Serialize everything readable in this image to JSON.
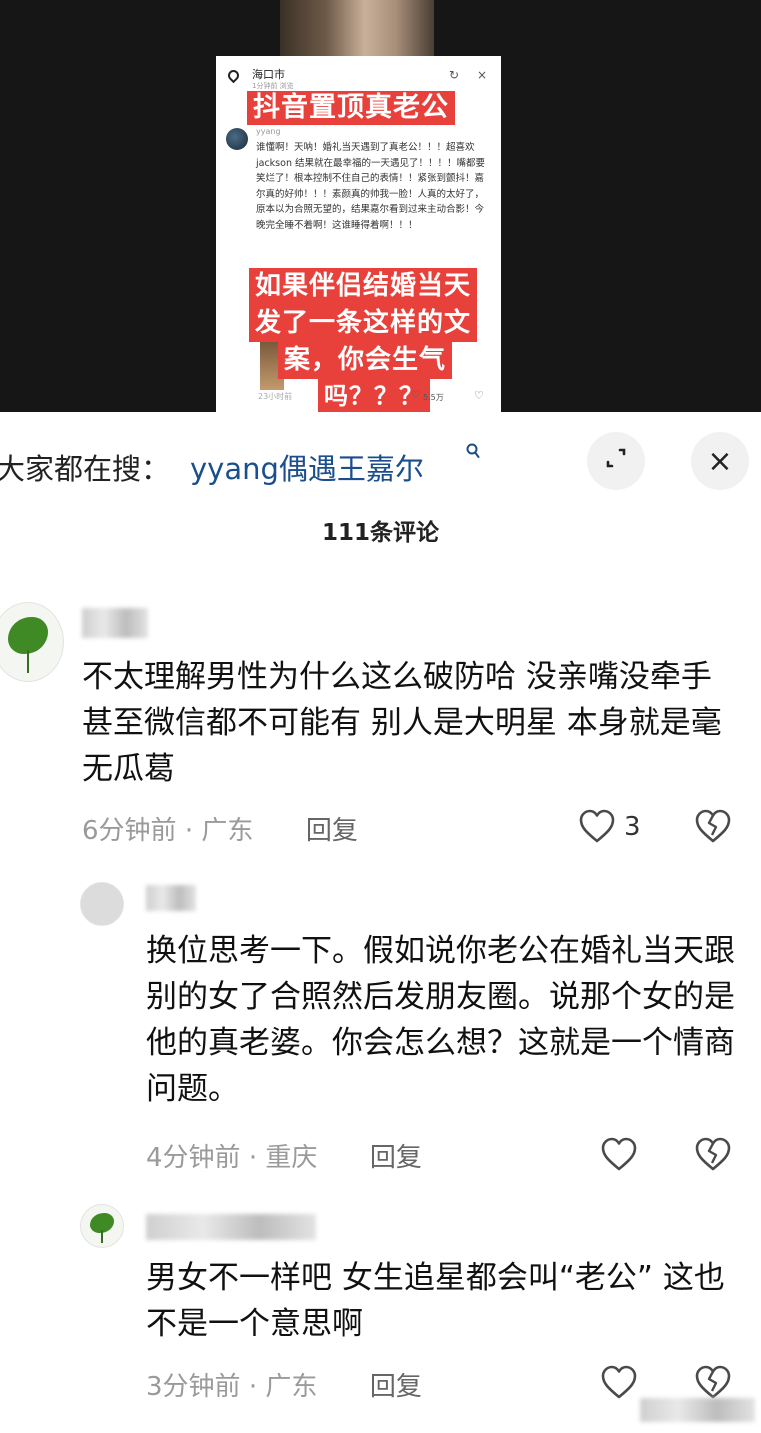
{
  "video": {
    "location": "海口市",
    "location_sub": "1分钟前 浏览",
    "headline": "抖音置顶真老公",
    "post_name": "yyang",
    "post_body": "谁懂啊！天呐！婚礼当天遇到了真老公！！！超喜欢jackson 结果就在最幸福的一天遇见了！！！！嘴都要笑烂了！根本控制不住自己的表情！！紧张到颤抖！嘉尔真的好帅！！！素颜真的帅我一脸！人真的太好了，原本以为合照无望的，结果嘉尔看到过来主动合影！今晚完全睡不着啊！这谁睡得着啊！！！",
    "overlay_lines": [
      "如果伴侣结婚当天",
      "发了一条这样的文",
      "案，你会生气",
      "吗？？？"
    ],
    "footer_time": "23小时前",
    "footer_likes": "5.5万"
  },
  "search": {
    "prefix": "大家都在搜：",
    "term": "yyang偶遇王嘉尔"
  },
  "comments_header": "111条评论",
  "comments": [
    {
      "text": "不太理解男性为什么这么破防哈 没亲嘴没牵手甚至微信都不可能有 别人是大明星 本身就是毫无瓜葛",
      "time": "6分钟前",
      "location": "广东",
      "reply": "回复",
      "likes": "3"
    },
    {
      "text": "换位思考一下。假如说你老公在婚礼当天跟别的女了合照然后发朋友圈。说那个女的是他的真老婆。你会怎么想？这就是一个情商问题。",
      "time": "4分钟前",
      "location": "重庆",
      "reply": "回复",
      "likes": ""
    },
    {
      "text": "男女不一样吧 女生追星都会叫“老公” 这也不是一个意思啊",
      "time": "3分钟前",
      "location": "广东",
      "reply": "回复",
      "likes": ""
    }
  ],
  "icons": {
    "close": "×",
    "expand": "expand-icon",
    "search": "search-icon"
  },
  "colors": {
    "search_term": "#1a4e8c",
    "banner_red": "#e8413b"
  }
}
